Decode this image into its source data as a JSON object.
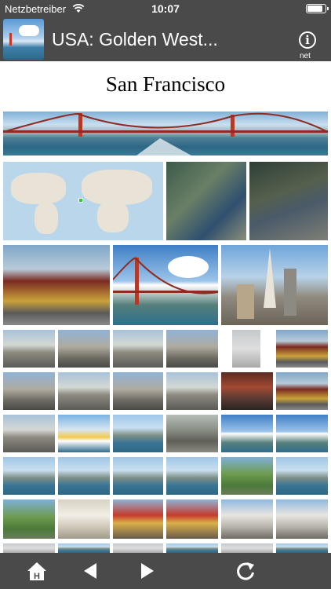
{
  "status_bar": {
    "carrier": "Netzbetreiber",
    "time": "10:07",
    "battery_level": 0.9
  },
  "nav_bar": {
    "title": "USA: Golden West...",
    "info_label": "net",
    "info_symbol": "i"
  },
  "main": {
    "title": "San Francisco"
  },
  "toolbar": {
    "home_letter": "H",
    "icons": [
      "home-icon",
      "back-arrow-icon",
      "forward-arrow-icon",
      "refresh-icon"
    ]
  },
  "colors": {
    "bar_background": "#4a4a4a",
    "page_background": "#ffffff"
  }
}
